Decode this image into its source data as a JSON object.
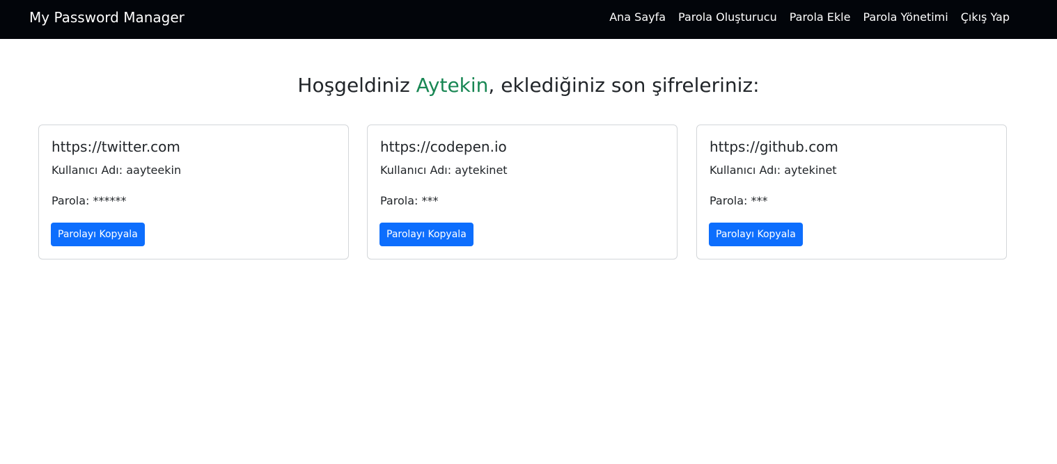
{
  "navbar": {
    "brand": "My Password Manager",
    "links": [
      "Ana Sayfa",
      "Parola Oluşturucu",
      "Parola Ekle",
      "Parola Yönetimi",
      "Çıkış Yap"
    ]
  },
  "heading": {
    "prefix": "Hoşgeldiniz",
    "username": "Aytekin",
    "suffix": ", eklediğiniz son şifreleriniz:"
  },
  "cards": [
    {
      "site": "https://twitter.com",
      "username_label": "Kullanıcı Adı:",
      "username": "aayteekin",
      "password_label": "Parola:",
      "password": "******",
      "button": "Parolayı Kopyala"
    },
    {
      "site": "https://codepen.io",
      "username_label": "Kullanıcı Adı:",
      "username": "aytekinet",
      "password_label": "Parola:",
      "password": "***",
      "button": "Parolayı Kopyala"
    },
    {
      "site": "https://github.com",
      "username_label": "Kullanıcı Adı:",
      "username": "aytekinet",
      "password_label": "Parola:",
      "password": "***",
      "button": "Parolayı Kopyala"
    }
  ],
  "colors": {
    "navbar_bg": "#02050a",
    "accent_username": "#198754",
    "primary_button": "#0d6efd"
  }
}
